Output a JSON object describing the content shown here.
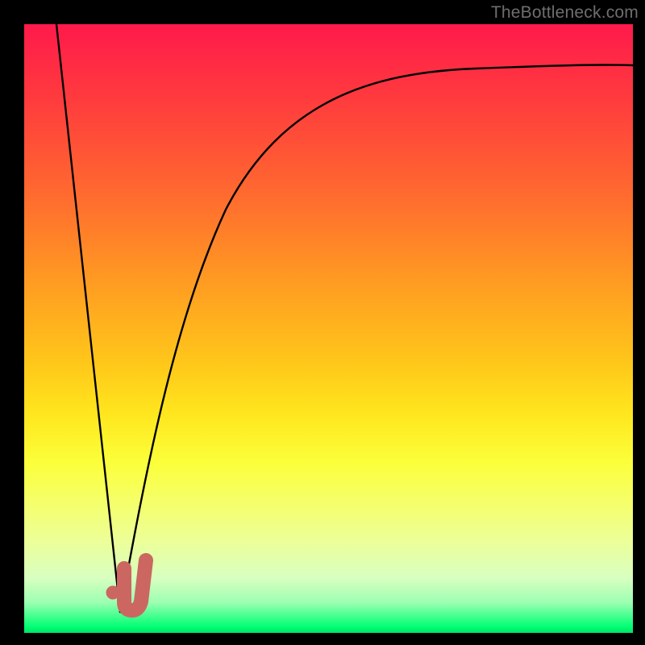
{
  "watermark": "TheBottleneck.com",
  "colors": {
    "frame": "#000000",
    "curve": "#000000",
    "marker": "#cb6760"
  },
  "chart_data": {
    "type": "line",
    "title": "",
    "xlabel": "",
    "ylabel": "",
    "xlim": [
      0,
      100
    ],
    "ylim": [
      0,
      100
    ],
    "legend": false,
    "grid": false,
    "background": "gradient-red-yellow-green",
    "series": [
      {
        "name": "left-branch",
        "x": [
          5.3,
          15.8
        ],
        "y": [
          100,
          3.5
        ]
      },
      {
        "name": "right-branch",
        "x": [
          15.8,
          17,
          18,
          20,
          22,
          25,
          28,
          32,
          36,
          40,
          45,
          50,
          55,
          60,
          70,
          80,
          90,
          100
        ],
        "y": [
          3.5,
          6,
          10,
          20,
          30,
          42,
          52,
          62,
          69,
          74,
          79,
          82.5,
          85,
          87,
          89.5,
          91.3,
          92.5,
          93.2
        ]
      }
    ],
    "markers": [
      {
        "name": "selected-point-dot",
        "x": 14.6,
        "y": 6.6
      },
      {
        "name": "selected-point-jmark-start",
        "x": 16.4,
        "y": 10.6
      },
      {
        "name": "selected-point-jmark-corner",
        "x": 16.6,
        "y": 3.7
      },
      {
        "name": "selected-point-jmark-end",
        "x": 20.0,
        "y": 11.9
      }
    ],
    "annotations": []
  }
}
